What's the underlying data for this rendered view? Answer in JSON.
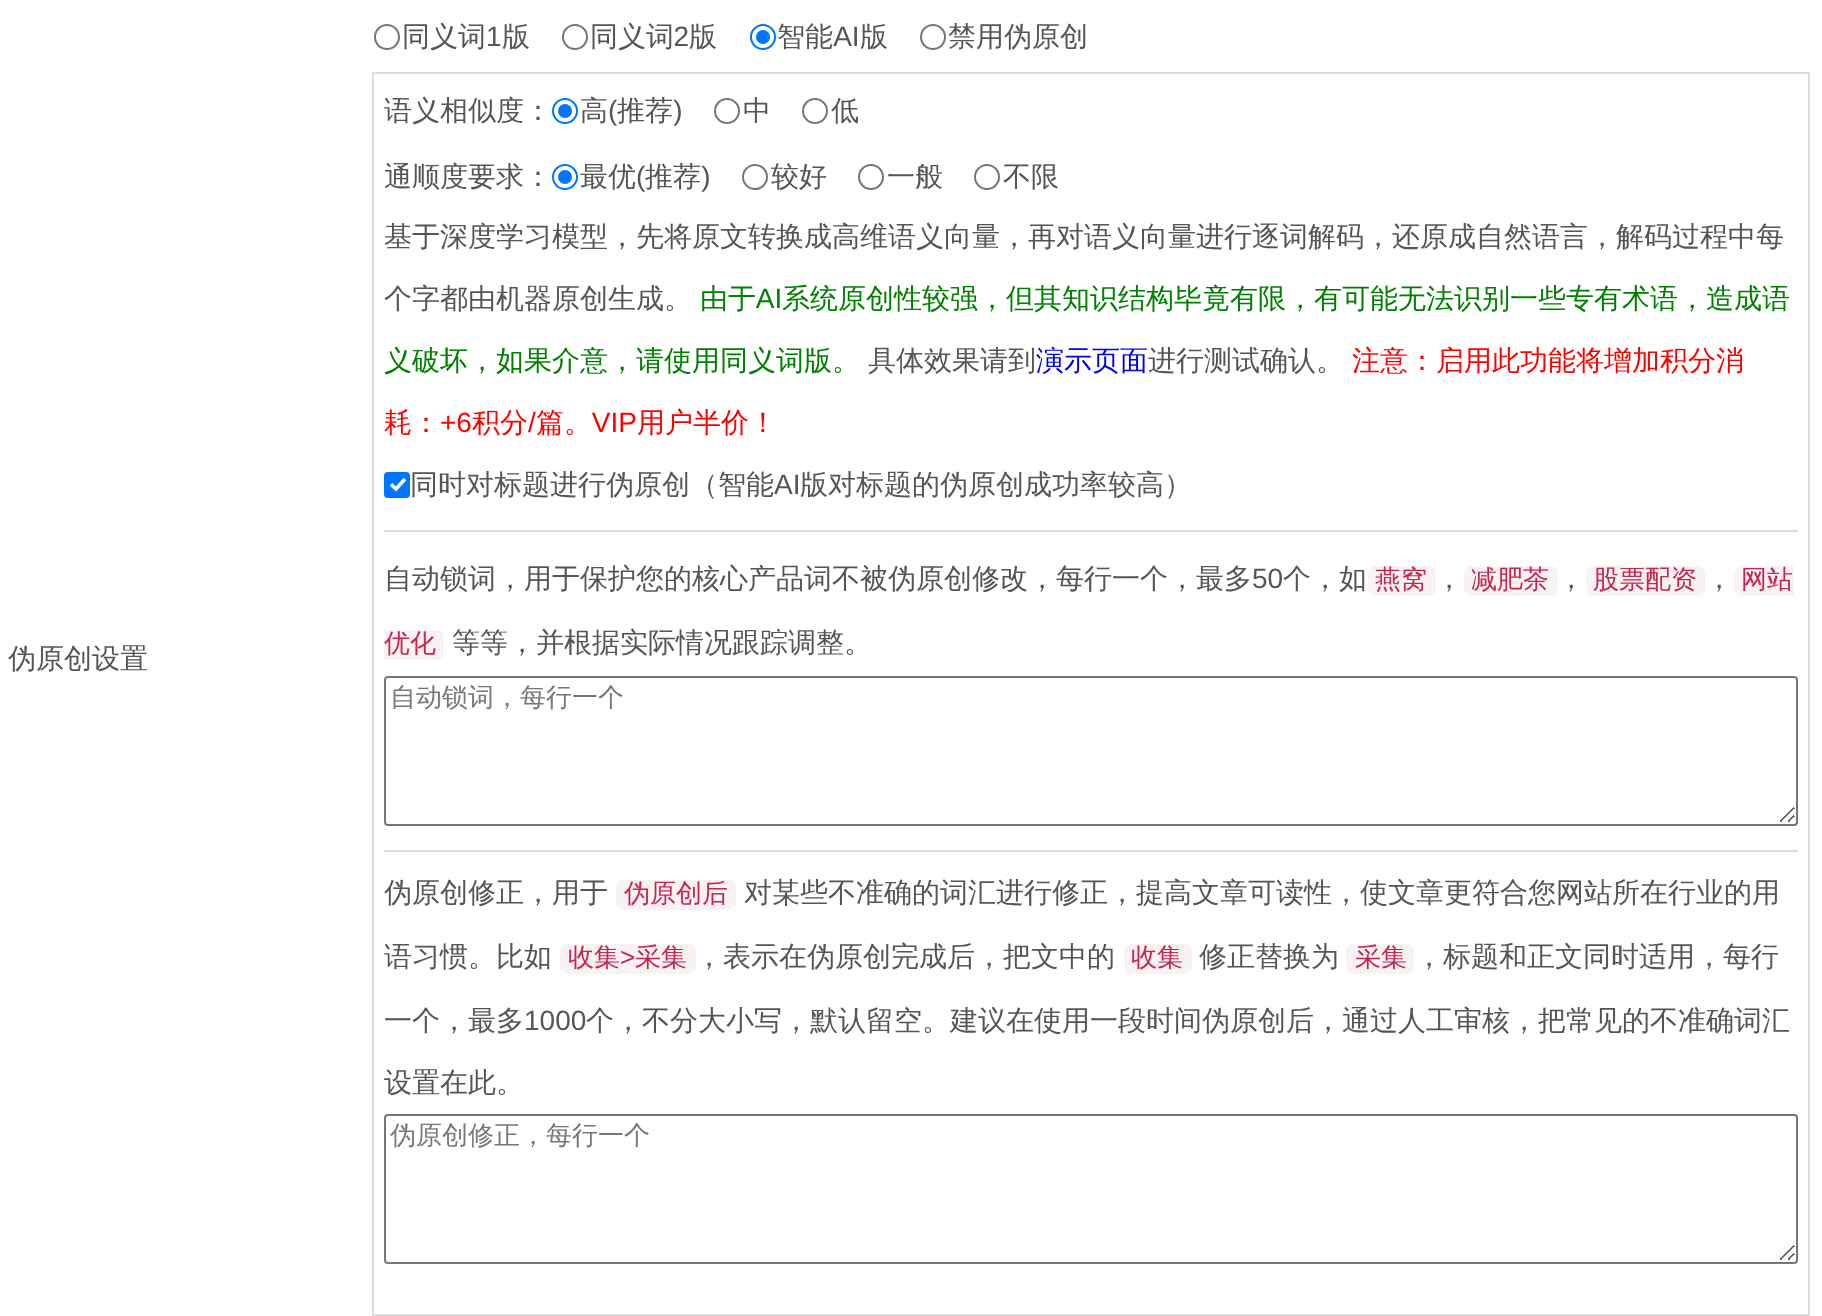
{
  "section_label": "伪原创设置",
  "modes": [
    {
      "label": "同义词1版",
      "selected": false
    },
    {
      "label": "同义词2版",
      "selected": false
    },
    {
      "label": "智能AI版",
      "selected": true
    },
    {
      "label": "禁用伪原创",
      "selected": false
    }
  ],
  "ai_options": [
    {
      "label": "语义相似度：",
      "options": [
        {
          "label": "高(推荐)",
          "selected": true
        },
        {
          "label": "中",
          "selected": false
        },
        {
          "label": "低",
          "selected": false
        }
      ]
    },
    {
      "label": "通顺度要求：",
      "options": [
        {
          "label": "最优(推荐)",
          "selected": true
        },
        {
          "label": "较好",
          "selected": false
        },
        {
          "label": "一般",
          "selected": false
        },
        {
          "label": "不限",
          "selected": false
        }
      ]
    }
  ],
  "description": [
    {
      "kind": "plain",
      "text": "基于深度学习模型，先将原文转换成高维语义向量，再对语义向量进行逐词解码，还原成自然语言，解码过程中每个字都由机器原创生成。 "
    },
    {
      "kind": "notice",
      "text": "由于AI系统原创性较强，但其知识结构毕竟有限，有可能无法识别一些专有术语，造成语义破坏，如果介意，请使用同义词版。"
    },
    {
      "kind": "plain",
      "text": " 具体效果请到"
    },
    {
      "kind": "link",
      "text": "演示页面"
    },
    {
      "kind": "plain",
      "text": "进行测试确认。 "
    },
    {
      "kind": "warning",
      "text": "注意：启用此功能将增加积分消耗：+6积分/篇。VIP用户半价！"
    }
  ],
  "title_option": {
    "label": "同时对标题进行伪原创（智能AI版对标题的伪原创成功率较高）",
    "checked": true
  },
  "lock_words": {
    "description": [
      {
        "kind": "plain",
        "text": "自动锁词，用于保护您的核心产品词不被伪原创修改，每行一个，最多50个，如"
      },
      {
        "kind": "code",
        "text": "燕窝"
      },
      {
        "kind": "plain",
        "text": "，"
      },
      {
        "kind": "code",
        "text": "减肥茶"
      },
      {
        "kind": "plain",
        "text": "，"
      },
      {
        "kind": "code",
        "text": "股票配资"
      },
      {
        "kind": "plain",
        "text": "，"
      },
      {
        "kind": "code",
        "text": "网站优化"
      },
      {
        "kind": "plain",
        "text": " 等等，并根据实际情况跟踪调整。"
      }
    ],
    "placeholder": "自动锁词，每行一个"
  },
  "corrections": {
    "description": [
      {
        "kind": "plain",
        "text": "伪原创修正，用于 "
      },
      {
        "kind": "code",
        "text": "伪原创后"
      },
      {
        "kind": "plain",
        "text": " 对某些不准确的词汇进行修正，提高文章可读性，使文章更符合您网站所在行业的用语习惯。比如 "
      },
      {
        "kind": "code",
        "text": "收集>采集"
      },
      {
        "kind": "plain",
        "text": "，表示在伪原创完成后，把文中的 "
      },
      {
        "kind": "code",
        "text": "收集"
      },
      {
        "kind": "plain",
        "text": " 修正替换为 "
      },
      {
        "kind": "code",
        "text": "采集"
      },
      {
        "kind": "plain",
        "text": "，标题和正文同时适用，每行一个，最多1000个，不分大小写，默认留空。建议在使用一段时间伪原创后，通过人工审核，把常见的不准确词汇设置在此。"
      }
    ],
    "placeholder": "伪原创修正，每行一个"
  }
}
